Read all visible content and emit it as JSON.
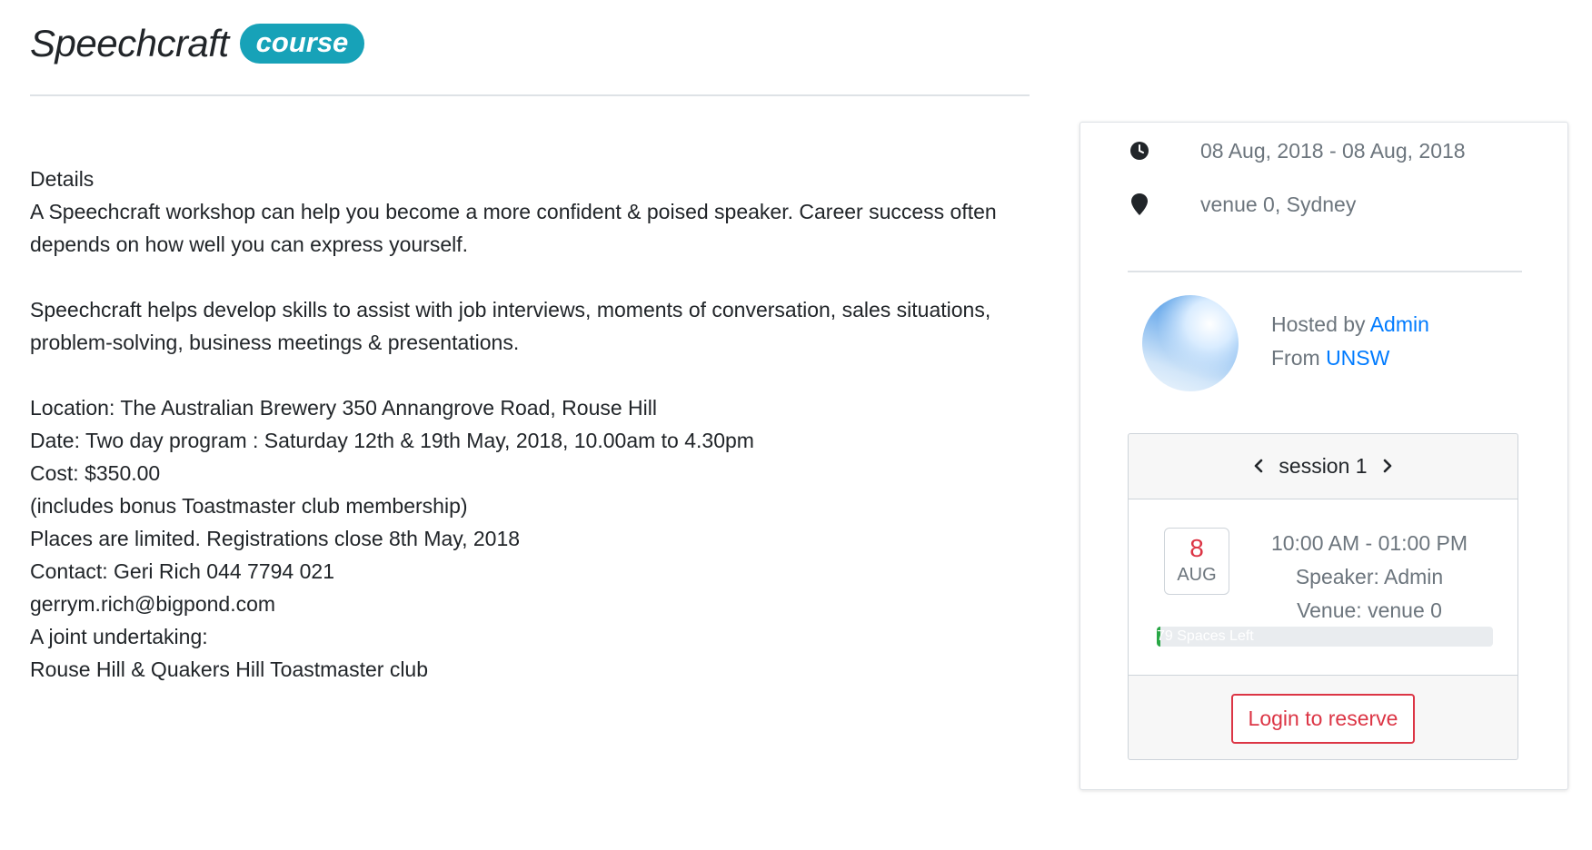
{
  "header": {
    "title": "Speechcraft",
    "badge": "course"
  },
  "details": {
    "lines": [
      "Details",
      "A Speechcraft workshop can help you become a more confident & poised speaker. Career success often depends on how well you can express yourself.",
      "",
      "Speechcraft helps develop skills to assist with job interviews, moments of conversation, sales situations, problem-solving, business meetings & presentations.",
      "",
      "Location: The Australian Brewery 350 Annangrove Road, Rouse Hill",
      "Date: Two day program : Saturday 12th & 19th May, 2018, 10.00am to 4.30pm",
      "Cost: $350.00",
      "(includes bonus Toastmaster club membership)",
      "Places are limited. Registrations close 8th May, 2018",
      "Contact: Geri Rich 044 7794 021",
      "gerrym.rich@bigpond.com",
      "A joint undertaking:",
      "Rouse Hill & Quakers Hill Toastmaster club"
    ]
  },
  "sidebar": {
    "date_range": "08 Aug, 2018 - 08 Aug, 2018",
    "location": "venue 0, Sydney",
    "host": {
      "hosted_by_label": "Hosted by",
      "host_name": "Admin",
      "from_label": "From",
      "org_name": "UNSW"
    },
    "session": {
      "title": "session 1",
      "day": "8",
      "month": "AUG",
      "time": "10:00 AM - 01:00 PM",
      "speaker": "Speaker: Admin",
      "venue": "Venue: venue 0",
      "spaces_label": "79 Spaces Left",
      "spaces_fill_fraction": 0.01,
      "login_button": "Login to reserve"
    }
  },
  "icons": {
    "clock": "clock-icon",
    "location": "map-marker-icon",
    "prev": "chevron-left-icon",
    "next": "chevron-right-icon"
  },
  "colors": {
    "badge": "#17a2b8",
    "link": "#007bff",
    "danger": "#dc3545",
    "progress": "#28a745"
  }
}
